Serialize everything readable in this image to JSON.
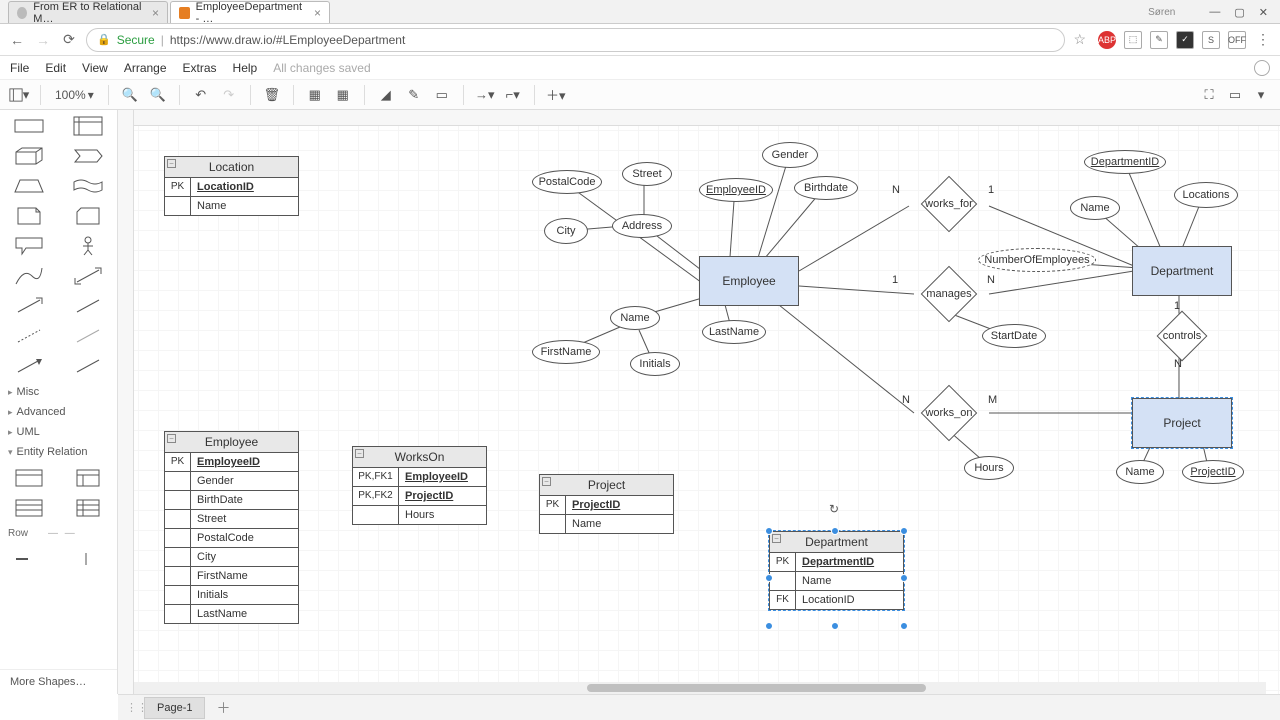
{
  "window": {
    "user": "Søren",
    "min": "—",
    "max": "▢",
    "close": "✕"
  },
  "tabs": [
    {
      "title": "From ER to Relational M…",
      "active": false
    },
    {
      "title": "EmployeeDepartment - …",
      "active": true
    }
  ],
  "addr": {
    "secure": "Secure",
    "url": "https://www.draw.io/#LEmployeeDepartment",
    "ext": [
      "ABP",
      "⬚",
      "✎",
      "✓",
      "S",
      "OFF"
    ]
  },
  "menu": {
    "items": [
      "File",
      "Edit",
      "View",
      "Arrange",
      "Extras",
      "Help"
    ],
    "status": "All changes saved"
  },
  "toolbar": {
    "zoom": "100%"
  },
  "sidebar": {
    "sections": [
      "Misc",
      "Advanced",
      "UML",
      "Entity Relation"
    ],
    "row_label": "Row",
    "more": "More Shapes…"
  },
  "tables": {
    "location": {
      "title": "Location",
      "rows": [
        {
          "k": "PK",
          "v": "LocationID",
          "pk": true
        },
        {
          "k": "",
          "v": "Name"
        }
      ]
    },
    "employee": {
      "title": "Employee",
      "rows": [
        {
          "k": "PK",
          "v": "EmployeeID",
          "pk": true
        },
        {
          "k": "",
          "v": "Gender"
        },
        {
          "k": "",
          "v": "BirthDate"
        },
        {
          "k": "",
          "v": "Street"
        },
        {
          "k": "",
          "v": "PostalCode"
        },
        {
          "k": "",
          "v": "City"
        },
        {
          "k": "",
          "v": "FirstName"
        },
        {
          "k": "",
          "v": "Initials"
        },
        {
          "k": "",
          "v": "LastName"
        }
      ]
    },
    "workson": {
      "title": "WorksOn",
      "rows": [
        {
          "k": "PK,FK1",
          "v": "EmployeeID",
          "pk": true
        },
        {
          "k": "PK,FK2",
          "v": "ProjectID",
          "pk": true
        },
        {
          "k": "",
          "v": "Hours"
        }
      ]
    },
    "project": {
      "title": "Project",
      "rows": [
        {
          "k": "PK",
          "v": "ProjectID",
          "pk": true
        },
        {
          "k": "",
          "v": "Name"
        }
      ]
    },
    "department": {
      "title": "Department",
      "rows": [
        {
          "k": "PK",
          "v": "DepartmentID",
          "pk": true
        },
        {
          "k": "",
          "v": "Name"
        },
        {
          "k": "FK",
          "v": "LocationID"
        }
      ]
    }
  },
  "er": {
    "entities": {
      "employee": "Employee",
      "department": "Department",
      "project": "Project"
    },
    "attrs": {
      "gender": "Gender",
      "birthdate": "Birthdate",
      "employeeid": "EmployeeID",
      "postal": "PostalCode",
      "street": "Street",
      "address": "Address",
      "city": "City",
      "name": "Name",
      "firstname": "FirstName",
      "lastname": "LastName",
      "initials": "Initials",
      "deptid": "DepartmentID",
      "locations": "Locations",
      "dname": "Name",
      "numemp": "NumberOfEmployees",
      "startdate": "StartDate",
      "hours": "Hours",
      "pname": "Name",
      "projectid": "ProjectID"
    },
    "rels": {
      "works_for": "works_for",
      "manages": "manages",
      "controls": "controls",
      "works_on": "works_on"
    },
    "card": {
      "n": "N",
      "one": "1",
      "m": "M"
    }
  },
  "footer": {
    "page": "Page-1"
  }
}
